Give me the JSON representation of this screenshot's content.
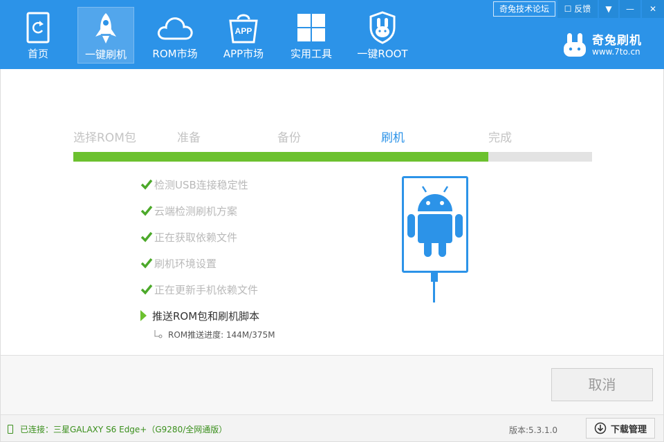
{
  "header": {
    "nav": [
      {
        "label": "首页",
        "icon": "home-refresh-icon"
      },
      {
        "label": "一键刷机",
        "icon": "rocket-icon",
        "active": true
      },
      {
        "label": "ROM市场",
        "icon": "cloud-icon"
      },
      {
        "label": "APP市场",
        "icon": "app-bag-icon",
        "badge": "APP"
      },
      {
        "label": "实用工具",
        "icon": "windows-grid-icon"
      },
      {
        "label": "一键ROOT",
        "icon": "shield-bunny-icon"
      }
    ],
    "forum_label": "奇兔技术论坛",
    "feedback_label": "反馈",
    "brand": {
      "name": "奇兔刷机",
      "url": "www.7to.cn"
    }
  },
  "steps": [
    {
      "label": "选择ROM包",
      "state": "done"
    },
    {
      "label": "准备",
      "state": "done"
    },
    {
      "label": "备份",
      "state": "done"
    },
    {
      "label": "刷机",
      "state": "current"
    },
    {
      "label": "完成",
      "state": "pending"
    }
  ],
  "progress": {
    "percent": 80
  },
  "tasks": [
    {
      "label": "检测USB连接稳定性",
      "state": "done"
    },
    {
      "label": "云端检测刷机方案",
      "state": "done"
    },
    {
      "label": "正在获取依赖文件",
      "state": "done"
    },
    {
      "label": "刷机环境设置",
      "state": "done"
    },
    {
      "label": "正在更新手机依赖文件",
      "state": "done"
    },
    {
      "label": "推送ROM包和刷机脚本",
      "state": "current"
    }
  ],
  "sub_progress": "ROM推送进度: 144M/375M",
  "actions": {
    "cancel_label": "取消"
  },
  "status": {
    "connection": "已连接：三星GALAXY S6 Edge+（G9280/全网通版）",
    "version": "版本:5.3.1.0",
    "download_label": "下载管理"
  },
  "colors": {
    "brand_blue": "#2c93e8",
    "progress_green": "#6cc12f",
    "check_green": "#4ca92a"
  }
}
